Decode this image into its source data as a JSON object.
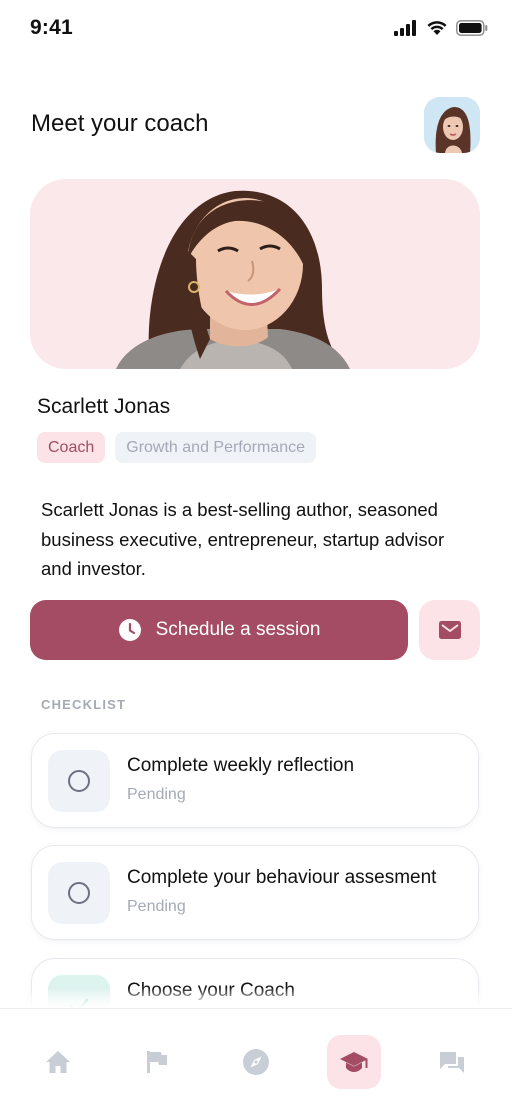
{
  "status_bar": {
    "time": "9:41"
  },
  "header": {
    "title": "Meet your coach"
  },
  "coach": {
    "name": "Scarlett Jonas",
    "tags": [
      "Coach",
      "Growth and Performance"
    ],
    "bio": "Scarlett Jonas is a best-selling author, seasoned business executive, entrepreneur, startup advisor and investor."
  },
  "actions": {
    "schedule_label": "Schedule a session"
  },
  "checklist": {
    "label": "CHECKLIST",
    "items": [
      {
        "title": "Complete weekly reflection",
        "status": "Pending"
      },
      {
        "title": "Complete your behaviour assesment",
        "status": "Pending"
      },
      {
        "title": "Choose your Coach",
        "status": ""
      }
    ]
  },
  "tabs": [
    "home-icon",
    "flag-icon",
    "compass-icon",
    "graduation-cap-icon",
    "chat-icon"
  ],
  "colors": {
    "accent": "#a34c63",
    "accent_light": "#fbe3e7",
    "done": "#5cc9ad"
  }
}
